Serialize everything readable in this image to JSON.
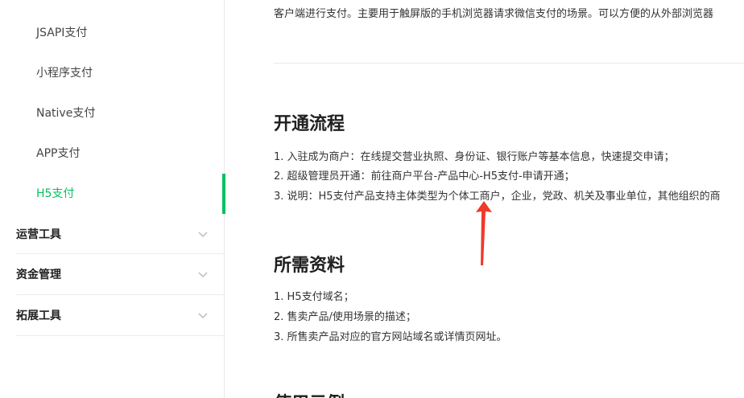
{
  "sidebar": {
    "sub_items": [
      {
        "label": "JSAPI支付"
      },
      {
        "label": "小程序支付"
      },
      {
        "label": "Native支付"
      },
      {
        "label": "APP支付"
      },
      {
        "label": "H5支付",
        "active": true
      }
    ],
    "groups": [
      {
        "label": "运营工具",
        "icon": "chevron-down-icon"
      },
      {
        "label": "资金管理",
        "icon": "chevron-down-icon"
      },
      {
        "label": "拓展工具",
        "icon": "chevron-down-icon"
      }
    ],
    "accent_color": "#07c160"
  },
  "content": {
    "intro_text": "客户端进行支付。主要用于触屏版的手机浏览器请求微信支付的场景。可以方便的从外部浏览器",
    "section_open": {
      "title": "开通流程",
      "lines": [
        "1. 入驻成为商户：在线提交营业执照、身份证、银行账户等基本信息，快速提交申请；",
        "2. 超级管理员开通：前往商户平台-产品中心-H5支付-申请开通；",
        "3. 说明：H5支付产品支持主体类型为个体工商户，企业，党政、机关及事业单位，其他组织的商"
      ]
    },
    "section_materials": {
      "title": "所需资料",
      "lines": [
        "1. H5支付域名；",
        "2. 售卖产品/使用场景的描述；",
        "3. 所售卖产品对应的官方网站域名或详情页网址。"
      ]
    },
    "section_next": {
      "title": "使用示例"
    },
    "annotation_arrow_color": "#f03a2a"
  }
}
